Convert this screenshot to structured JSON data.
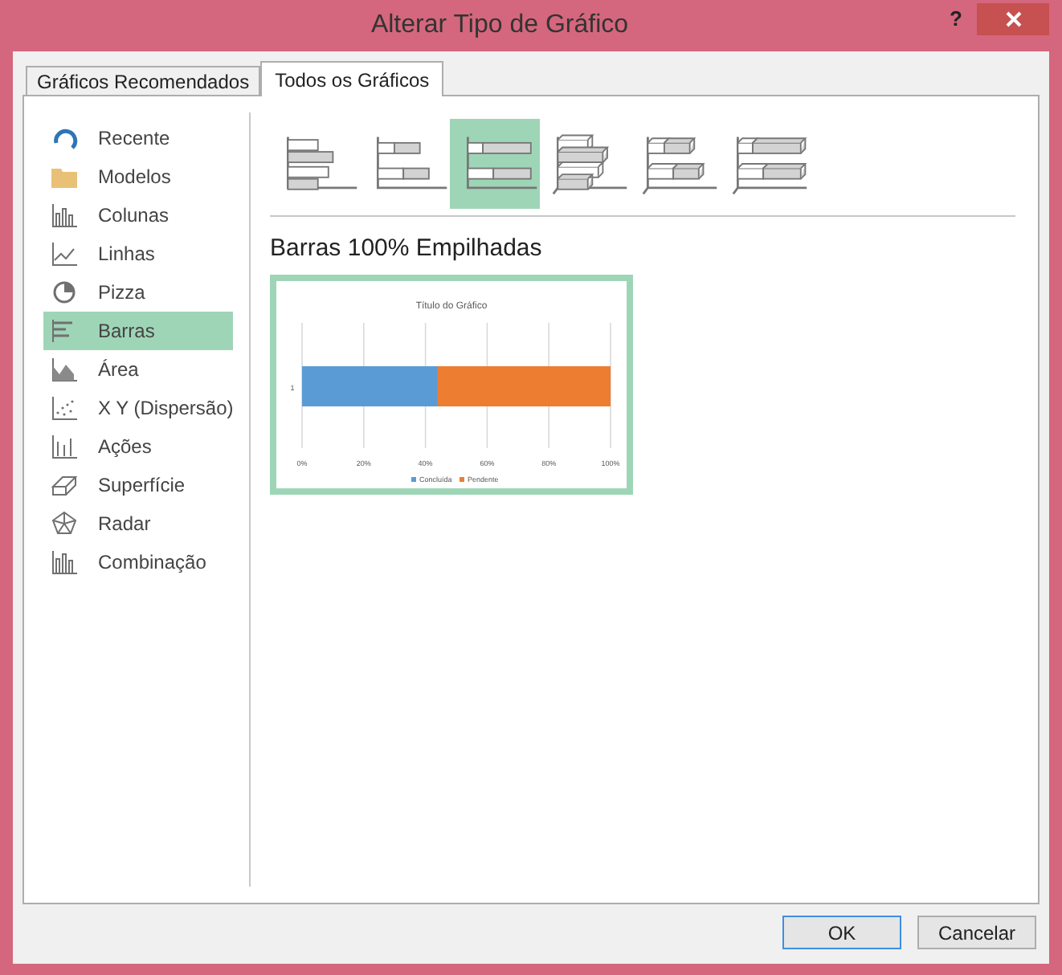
{
  "window": {
    "title": "Alterar Tipo de Gráfico",
    "help": "?"
  },
  "tabs": [
    {
      "label": "Gráficos Recomendados",
      "selected": false
    },
    {
      "label": "Todos os Gráficos",
      "selected": true
    }
  ],
  "sidebar": {
    "items": [
      {
        "label": "Recente",
        "kind": "recent",
        "selected": false
      },
      {
        "label": "Modelos",
        "kind": "folder",
        "selected": false
      },
      {
        "label": "Colunas",
        "kind": "column",
        "selected": false
      },
      {
        "label": "Linhas",
        "kind": "line",
        "selected": false
      },
      {
        "label": "Pizza",
        "kind": "pie",
        "selected": false
      },
      {
        "label": "Barras",
        "kind": "bar",
        "selected": true
      },
      {
        "label": "Área",
        "kind": "area",
        "selected": false
      },
      {
        "label": "X Y (Dispersão)",
        "kind": "scatter",
        "selected": false
      },
      {
        "label": "Ações",
        "kind": "stock",
        "selected": false
      },
      {
        "label": "Superfície",
        "kind": "surface",
        "selected": false
      },
      {
        "label": "Radar",
        "kind": "radar",
        "selected": false
      },
      {
        "label": "Combinação",
        "kind": "combo",
        "selected": false
      }
    ]
  },
  "subtypes": [
    {
      "kind": "clustered",
      "selected": false
    },
    {
      "kind": "stacked",
      "selected": false
    },
    {
      "kind": "stacked100",
      "selected": true
    },
    {
      "kind": "clustered3d",
      "selected": false
    },
    {
      "kind": "stacked3d",
      "selected": false
    },
    {
      "kind": "stacked100_3d",
      "selected": false
    }
  ],
  "preview": {
    "heading": "Barras 100% Empilhadas",
    "chart_data": {
      "type": "bar",
      "orientation": "horizontal",
      "stacked": true,
      "title": "Título do Gráfico",
      "categories": [
        "1"
      ],
      "series": [
        {
          "name": "Concluída",
          "color": "#5b9bd5",
          "values": [
            44
          ]
        },
        {
          "name": "Pendente",
          "color": "#ed7d31",
          "values": [
            56
          ]
        }
      ],
      "xlim": [
        0,
        100
      ],
      "grid": true,
      "legend": "bottom",
      "xticks": [
        {
          "value": 0,
          "label": "0%"
        },
        {
          "value": 20,
          "label": "20%"
        },
        {
          "value": 40,
          "label": "40%"
        },
        {
          "value": 60,
          "label": "60%"
        },
        {
          "value": 80,
          "label": "80%"
        },
        {
          "value": 100,
          "label": "100%"
        }
      ]
    }
  },
  "buttons": [
    "OK",
    "Cancelar"
  ]
}
